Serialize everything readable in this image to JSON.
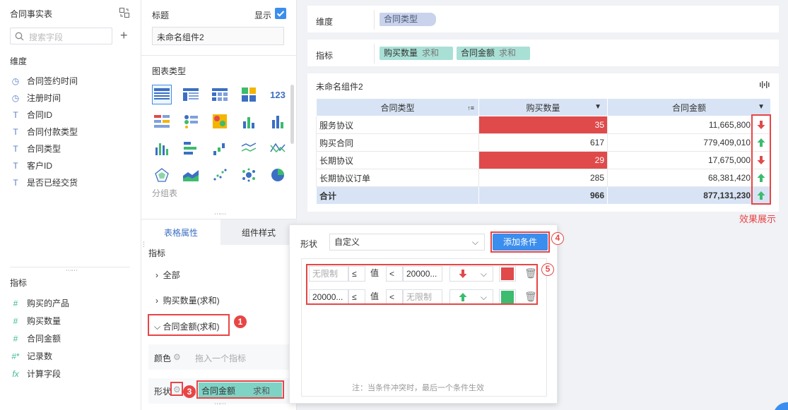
{
  "left": {
    "dataset_title": "合同事实表",
    "search_placeholder": "搜索字段",
    "dimension_label": "维度",
    "dimensions": [
      {
        "icon": "clock-icon",
        "glyph": "◷",
        "label": "合同签约时间"
      },
      {
        "icon": "clock-icon",
        "glyph": "◷",
        "label": "注册时间"
      },
      {
        "icon": "text-field-icon",
        "glyph": "T",
        "label": "合同ID"
      },
      {
        "icon": "text-field-icon",
        "glyph": "T",
        "label": "合同付款类型"
      },
      {
        "icon": "text-field-icon",
        "glyph": "T",
        "label": "合同类型"
      },
      {
        "icon": "text-field-icon",
        "glyph": "T",
        "label": "客户ID"
      },
      {
        "icon": "text-field-icon",
        "glyph": "T",
        "label": "是否已经交货"
      }
    ],
    "indicator_label": "指标",
    "indicators": [
      {
        "icon": "number-field-icon",
        "glyph": "#",
        "label": "购买的产品"
      },
      {
        "icon": "number-field-icon",
        "glyph": "#",
        "label": "购买数量"
      },
      {
        "icon": "number-field-icon",
        "glyph": "#",
        "label": "合同金额"
      },
      {
        "icon": "record-count-icon",
        "glyph": "#*",
        "label": "记录数"
      },
      {
        "icon": "function-icon",
        "glyph": "fx",
        "label": "计算字段"
      }
    ]
  },
  "middle": {
    "title_label": "标题",
    "show_label": "显示",
    "title_value": "未命名组件2",
    "chart_type_label": "图表类型",
    "chart_type_group": "分组表",
    "tab_table_props": "表格属性",
    "tab_component_style": "组件样式",
    "indicator_section": "指标",
    "tree_all": "全部",
    "tree_qty": "购买数量(求和)",
    "tree_amount": "合同金额(求和)",
    "color_label": "颜色",
    "color_placeholder": "拖入一个指标",
    "shape_label": "形状",
    "shape_field": "合同金额",
    "shape_agg": "求和"
  },
  "right": {
    "dimension_label": "维度",
    "dimension_pill": "合同类型",
    "indicator_label": "指标",
    "indicator_pills": [
      {
        "name": "购买数量",
        "agg": "求和"
      },
      {
        "name": "合同金额",
        "agg": "求和"
      }
    ],
    "component_title": "未命名组件2",
    "table": {
      "headers": [
        "合同类型",
        "购买数量",
        "合同金额"
      ],
      "rows": [
        {
          "type": "服务协议",
          "qty": "35",
          "amount": "11,665,800",
          "qty_hl": true,
          "arrow": "down"
        },
        {
          "type": "购买合同",
          "qty": "617",
          "amount": "779,409,010",
          "qty_hl": false,
          "arrow": "up"
        },
        {
          "type": "长期协议",
          "qty": "29",
          "amount": "17,675,000",
          "qty_hl": true,
          "arrow": "down"
        },
        {
          "type": "长期协议订单",
          "qty": "285",
          "amount": "68,381,420",
          "qty_hl": false,
          "arrow": "up"
        }
      ],
      "total": {
        "type": "合计",
        "qty": "966",
        "amount": "877,131,230",
        "arrow": "up"
      }
    },
    "effect_label": "效果展示"
  },
  "popup": {
    "shape_label": "形状",
    "shape_value": "自定义",
    "add_button": "添加条件",
    "conditions": [
      {
        "min": "无限制",
        "op1": "≤",
        "value_label": "值",
        "op2": "<",
        "max": "20000...",
        "arrow": "down",
        "color": "#e04a4a"
      },
      {
        "min": "20000...",
        "op1": "≤",
        "value_label": "值",
        "op2": "<",
        "max": "无限制",
        "arrow": "up",
        "color": "#3dbb6e"
      }
    ],
    "note": "注：当条件冲突时，最后一个条件生效"
  },
  "badges": [
    "1",
    "2",
    "3",
    "4",
    "5"
  ],
  "colors": {
    "accent": "#3b8eed",
    "red": "#e04a4a",
    "green": "#3dbb6e",
    "annotation": "#e84545"
  }
}
